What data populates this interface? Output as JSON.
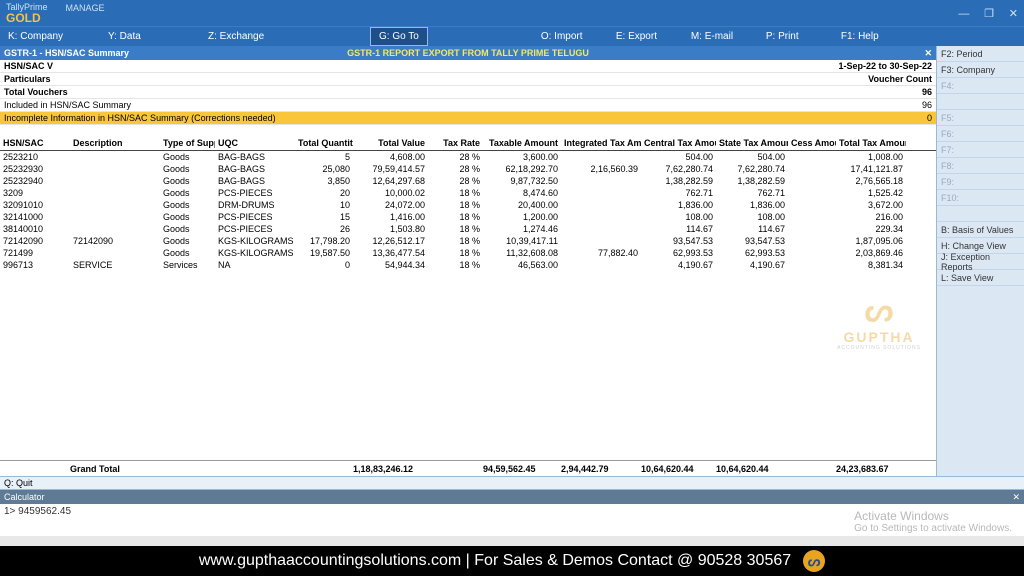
{
  "app": {
    "name": "TallyPrime",
    "edition": "GOLD",
    "manage": "MANAGE"
  },
  "menu": {
    "company": "K: Company",
    "data": "Y: Data",
    "exchange": "Z: Exchange",
    "goto": "G: Go To",
    "import": "O: Import",
    "export": "E: Export",
    "email": "M: E-mail",
    "print": "P: Print",
    "help": "F1: Help"
  },
  "report": {
    "header_left": "GSTR-1  -  HSN/SAC Summary",
    "header_center": "GSTR-1 REPORT EXPORT FROM TALLY PRIME TELUGU",
    "line1_l": "HSN/SAC V",
    "period": "1-Sep-22 to 30-Sep-22",
    "line2_l": "Particulars",
    "line2_r": "Voucher Count",
    "line3_l": "Total Vouchers",
    "line3_r": "96",
    "line4_l": "   Included in HSN/SAC Summary",
    "line4_r": "96",
    "warn_l": "   Incomplete Information in HSN/SAC Summary (Corrections needed)",
    "warn_r": "0"
  },
  "cols": {
    "hsn": "HSN/SAC",
    "desc": "Description",
    "type": "Type of Supply",
    "uqc": "UQC",
    "qty": "Total Quantity",
    "val": "Total Value",
    "rate": "Tax Rate",
    "taxable": "Taxable Amount",
    "itax": "Integrated Tax Amount",
    "ctax": "Central Tax Amount",
    "stax": "State Tax Amount",
    "cess": "Cess Amount",
    "ttax": "Total Tax Amount"
  },
  "rows": [
    {
      "hsn": "2523210",
      "desc": "",
      "type": "Goods",
      "uqc": "BAG-BAGS",
      "qty": "5",
      "val": "4,608.00",
      "rate": "28 %",
      "taxable": "3,600.00",
      "itax": "",
      "ctax": "504.00",
      "stax": "504.00",
      "cess": "",
      "ttax": "1,008.00"
    },
    {
      "hsn": "25232930",
      "desc": "",
      "type": "Goods",
      "uqc": "BAG-BAGS",
      "qty": "25,080",
      "val": "79,59,414.57",
      "rate": "28 %",
      "taxable": "62,18,292.70",
      "itax": "2,16,560.39",
      "ctax": "7,62,280.74",
      "stax": "7,62,280.74",
      "cess": "",
      "ttax": "17,41,121.87"
    },
    {
      "hsn": "25232940",
      "desc": "",
      "type": "Goods",
      "uqc": "BAG-BAGS",
      "qty": "3,850",
      "val": "12,64,297.68",
      "rate": "28 %",
      "taxable": "9,87,732.50",
      "itax": "",
      "ctax": "1,38,282.59",
      "stax": "1,38,282.59",
      "cess": "",
      "ttax": "2,76,565.18"
    },
    {
      "hsn": "3209",
      "desc": "",
      "type": "Goods",
      "uqc": "PCS-PIECES",
      "qty": "20",
      "val": "10,000.02",
      "rate": "18 %",
      "taxable": "8,474.60",
      "itax": "",
      "ctax": "762.71",
      "stax": "762.71",
      "cess": "",
      "ttax": "1,525.42"
    },
    {
      "hsn": "32091010",
      "desc": "",
      "type": "Goods",
      "uqc": "DRM-DRUMS",
      "qty": "10",
      "val": "24,072.00",
      "rate": "18 %",
      "taxable": "20,400.00",
      "itax": "",
      "ctax": "1,836.00",
      "stax": "1,836.00",
      "cess": "",
      "ttax": "3,672.00"
    },
    {
      "hsn": "32141000",
      "desc": "",
      "type": "Goods",
      "uqc": "PCS-PIECES",
      "qty": "15",
      "val": "1,416.00",
      "rate": "18 %",
      "taxable": "1,200.00",
      "itax": "",
      "ctax": "108.00",
      "stax": "108.00",
      "cess": "",
      "ttax": "216.00"
    },
    {
      "hsn": "38140010",
      "desc": "",
      "type": "Goods",
      "uqc": "PCS-PIECES",
      "qty": "26",
      "val": "1,503.80",
      "rate": "18 %",
      "taxable": "1,274.46",
      "itax": "",
      "ctax": "114.67",
      "stax": "114.67",
      "cess": "",
      "ttax": "229.34"
    },
    {
      "hsn": "72142090",
      "desc": "72142090",
      "type": "Goods",
      "uqc": "KGS-KILOGRAMS",
      "qty": "17,798.20",
      "val": "12,26,512.17",
      "rate": "18 %",
      "taxable": "10,39,417.11",
      "itax": "",
      "ctax": "93,547.53",
      "stax": "93,547.53",
      "cess": "",
      "ttax": "1,87,095.06"
    },
    {
      "hsn": "721499",
      "desc": "",
      "type": "Goods",
      "uqc": "KGS-KILOGRAMS",
      "qty": "19,587.50",
      "val": "13,36,477.54",
      "rate": "18 %",
      "taxable": "11,32,608.08",
      "itax": "77,882.40",
      "ctax": "62,993.53",
      "stax": "62,993.53",
      "cess": "",
      "ttax": "2,03,869.46"
    },
    {
      "hsn": "996713",
      "desc": "SERVICE",
      "type": "Services",
      "uqc": "NA",
      "qty": "0",
      "val": "54,944.34",
      "rate": "18 %",
      "taxable": "46,563.00",
      "itax": "",
      "ctax": "4,190.67",
      "stax": "4,190.67",
      "cess": "",
      "ttax": "8,381.34"
    }
  ],
  "grand": {
    "label": "Grand Total",
    "val": "1,18,83,246.12",
    "taxable": "94,59,562.45",
    "itax": "2,94,442.79",
    "ctax": "10,64,620.44",
    "stax": "10,64,620.44",
    "ttax": "24,23,683.67"
  },
  "sidebar": [
    {
      "label": "F2: Period",
      "enabled": true
    },
    {
      "label": "F3: Company",
      "enabled": true
    },
    {
      "label": "F4:",
      "enabled": false
    },
    {
      "label": "",
      "enabled": false
    },
    {
      "label": "F5:",
      "enabled": false
    },
    {
      "label": "F6:",
      "enabled": false
    },
    {
      "label": "F7:",
      "enabled": false
    },
    {
      "label": "F8:",
      "enabled": false
    },
    {
      "label": "F9:",
      "enabled": false
    },
    {
      "label": "F10:",
      "enabled": false
    },
    {
      "label": "",
      "enabled": false
    },
    {
      "label": "B: Basis of Values",
      "enabled": true
    },
    {
      "label": "H: Change View",
      "enabled": true
    },
    {
      "label": "J: Exception Reports",
      "enabled": true
    },
    {
      "label": "L: Save View",
      "enabled": true
    }
  ],
  "quit": "Q: Quit",
  "calculator": "Calculator",
  "calc_line": "1> 9459562.45",
  "activate": {
    "t": "Activate Windows",
    "s": "Go to Settings to activate Windows."
  },
  "footer": "www.gupthaaccountingsolutions.com | For Sales & Demos Contact @ 90528 30567",
  "watermark": {
    "brand": "GUPTHA",
    "sub": "ACCOUNTING SOLUTIONS"
  }
}
